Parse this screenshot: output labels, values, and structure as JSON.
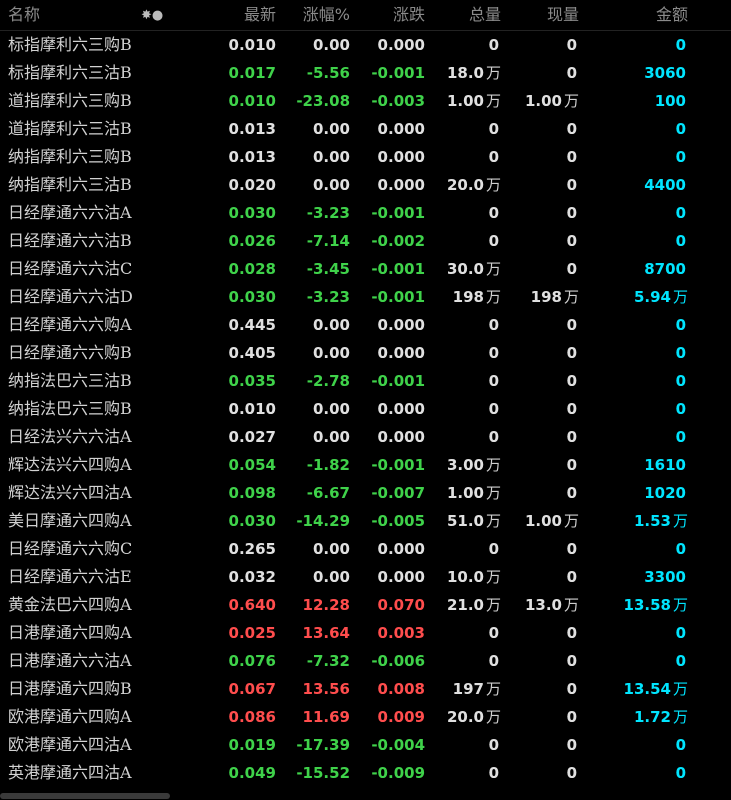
{
  "header": {
    "name": "名称",
    "price": "最新",
    "pct": "涨幅%",
    "chg": "涨跌",
    "vol": "总量",
    "cur": "现量",
    "amt": "金额",
    "settings_icon": "✸●"
  },
  "colors": {
    "up": "#ff4d4d",
    "down": "#3fd24a",
    "flat": "#e0e0e0",
    "amount": "#00e5ff"
  },
  "rows": [
    {
      "name": "标指摩利六三购B",
      "price": "0.010",
      "pct": "0.00",
      "chg": "0.000",
      "vol": "0",
      "vol_unit": "",
      "cur": "0",
      "cur_unit": "",
      "amt": "0",
      "amt_unit": "",
      "trend": "w"
    },
    {
      "name": "标指摩利六三沽B",
      "price": "0.017",
      "pct": "-5.56",
      "chg": "-0.001",
      "vol": "18.0",
      "vol_unit": "万",
      "cur": "0",
      "cur_unit": "",
      "amt": "3060",
      "amt_unit": "",
      "trend": "g"
    },
    {
      "name": "道指摩利六三购B",
      "price": "0.010",
      "pct": "-23.08",
      "chg": "-0.003",
      "vol": "1.00",
      "vol_unit": "万",
      "cur": "1.00",
      "cur_unit": "万",
      "amt": "100",
      "amt_unit": "",
      "trend": "g"
    },
    {
      "name": "道指摩利六三沽B",
      "price": "0.013",
      "pct": "0.00",
      "chg": "0.000",
      "vol": "0",
      "vol_unit": "",
      "cur": "0",
      "cur_unit": "",
      "amt": "0",
      "amt_unit": "",
      "trend": "w"
    },
    {
      "name": "纳指摩利六三购B",
      "price": "0.013",
      "pct": "0.00",
      "chg": "0.000",
      "vol": "0",
      "vol_unit": "",
      "cur": "0",
      "cur_unit": "",
      "amt": "0",
      "amt_unit": "",
      "trend": "w"
    },
    {
      "name": "纳指摩利六三沽B",
      "price": "0.020",
      "pct": "0.00",
      "chg": "0.000",
      "vol": "20.0",
      "vol_unit": "万",
      "cur": "0",
      "cur_unit": "",
      "amt": "4400",
      "amt_unit": "",
      "trend": "w"
    },
    {
      "name": "日经摩通六六沽A",
      "price": "0.030",
      "pct": "-3.23",
      "chg": "-0.001",
      "vol": "0",
      "vol_unit": "",
      "cur": "0",
      "cur_unit": "",
      "amt": "0",
      "amt_unit": "",
      "trend": "g"
    },
    {
      "name": "日经摩通六六沽B",
      "price": "0.026",
      "pct": "-7.14",
      "chg": "-0.002",
      "vol": "0",
      "vol_unit": "",
      "cur": "0",
      "cur_unit": "",
      "amt": "0",
      "amt_unit": "",
      "trend": "g"
    },
    {
      "name": "日经摩通六六沽C",
      "price": "0.028",
      "pct": "-3.45",
      "chg": "-0.001",
      "vol": "30.0",
      "vol_unit": "万",
      "cur": "0",
      "cur_unit": "",
      "amt": "8700",
      "amt_unit": "",
      "trend": "g"
    },
    {
      "name": "日经摩通六六沽D",
      "price": "0.030",
      "pct": "-3.23",
      "chg": "-0.001",
      "vol": "198",
      "vol_unit": "万",
      "cur": "198",
      "cur_unit": "万",
      "amt": "5.94",
      "amt_unit": "万",
      "trend": "g"
    },
    {
      "name": "日经摩通六六购A",
      "price": "0.445",
      "pct": "0.00",
      "chg": "0.000",
      "vol": "0",
      "vol_unit": "",
      "cur": "0",
      "cur_unit": "",
      "amt": "0",
      "amt_unit": "",
      "trend": "w"
    },
    {
      "name": "日经摩通六六购B",
      "price": "0.405",
      "pct": "0.00",
      "chg": "0.000",
      "vol": "0",
      "vol_unit": "",
      "cur": "0",
      "cur_unit": "",
      "amt": "0",
      "amt_unit": "",
      "trend": "w"
    },
    {
      "name": "纳指法巴六三沽B",
      "price": "0.035",
      "pct": "-2.78",
      "chg": "-0.001",
      "vol": "0",
      "vol_unit": "",
      "cur": "0",
      "cur_unit": "",
      "amt": "0",
      "amt_unit": "",
      "trend": "g"
    },
    {
      "name": "纳指法巴六三购B",
      "price": "0.010",
      "pct": "0.00",
      "chg": "0.000",
      "vol": "0",
      "vol_unit": "",
      "cur": "0",
      "cur_unit": "",
      "amt": "0",
      "amt_unit": "",
      "trend": "w"
    },
    {
      "name": "日经法兴六六沽A",
      "price": "0.027",
      "pct": "0.00",
      "chg": "0.000",
      "vol": "0",
      "vol_unit": "",
      "cur": "0",
      "cur_unit": "",
      "amt": "0",
      "amt_unit": "",
      "trend": "w"
    },
    {
      "name": "辉达法兴六四购A",
      "price": "0.054",
      "pct": "-1.82",
      "chg": "-0.001",
      "vol": "3.00",
      "vol_unit": "万",
      "cur": "0",
      "cur_unit": "",
      "amt": "1610",
      "amt_unit": "",
      "trend": "g"
    },
    {
      "name": "辉达法兴六四沽A",
      "price": "0.098",
      "pct": "-6.67",
      "chg": "-0.007",
      "vol": "1.00",
      "vol_unit": "万",
      "cur": "0",
      "cur_unit": "",
      "amt": "1020",
      "amt_unit": "",
      "trend": "g"
    },
    {
      "name": "美日摩通六四购A",
      "price": "0.030",
      "pct": "-14.29",
      "chg": "-0.005",
      "vol": "51.0",
      "vol_unit": "万",
      "cur": "1.00",
      "cur_unit": "万",
      "amt": "1.53",
      "amt_unit": "万",
      "trend": "g"
    },
    {
      "name": "日经摩通六六购C",
      "price": "0.265",
      "pct": "0.00",
      "chg": "0.000",
      "vol": "0",
      "vol_unit": "",
      "cur": "0",
      "cur_unit": "",
      "amt": "0",
      "amt_unit": "",
      "trend": "w"
    },
    {
      "name": "日经摩通六六沽E",
      "price": "0.032",
      "pct": "0.00",
      "chg": "0.000",
      "vol": "10.0",
      "vol_unit": "万",
      "cur": "0",
      "cur_unit": "",
      "amt": "3300",
      "amt_unit": "",
      "trend": "w"
    },
    {
      "name": "黄金法巴六四购A",
      "price": "0.640",
      "pct": "12.28",
      "chg": "0.070",
      "vol": "21.0",
      "vol_unit": "万",
      "cur": "13.0",
      "cur_unit": "万",
      "amt": "13.58",
      "amt_unit": "万",
      "trend": "r"
    },
    {
      "name": "日港摩通六四购A",
      "price": "0.025",
      "pct": "13.64",
      "chg": "0.003",
      "vol": "0",
      "vol_unit": "",
      "cur": "0",
      "cur_unit": "",
      "amt": "0",
      "amt_unit": "",
      "trend": "r"
    },
    {
      "name": "日港摩通六六沽A",
      "price": "0.076",
      "pct": "-7.32",
      "chg": "-0.006",
      "vol": "0",
      "vol_unit": "",
      "cur": "0",
      "cur_unit": "",
      "amt": "0",
      "amt_unit": "",
      "trend": "g"
    },
    {
      "name": "日港摩通六四购B",
      "price": "0.067",
      "pct": "13.56",
      "chg": "0.008",
      "vol": "197",
      "vol_unit": "万",
      "cur": "0",
      "cur_unit": "",
      "amt": "13.54",
      "amt_unit": "万",
      "trend": "r"
    },
    {
      "name": "欧港摩通六四购A",
      "price": "0.086",
      "pct": "11.69",
      "chg": "0.009",
      "vol": "20.0",
      "vol_unit": "万",
      "cur": "0",
      "cur_unit": "",
      "amt": "1.72",
      "amt_unit": "万",
      "trend": "r"
    },
    {
      "name": "欧港摩通六四沽A",
      "price": "0.019",
      "pct": "-17.39",
      "chg": "-0.004",
      "vol": "0",
      "vol_unit": "",
      "cur": "0",
      "cur_unit": "",
      "amt": "0",
      "amt_unit": "",
      "trend": "g"
    },
    {
      "name": "英港摩通六四沽A",
      "price": "0.049",
      "pct": "-15.52",
      "chg": "-0.009",
      "vol": "0",
      "vol_unit": "",
      "cur": "0",
      "cur_unit": "",
      "amt": "0",
      "amt_unit": "",
      "trend": "g"
    }
  ]
}
